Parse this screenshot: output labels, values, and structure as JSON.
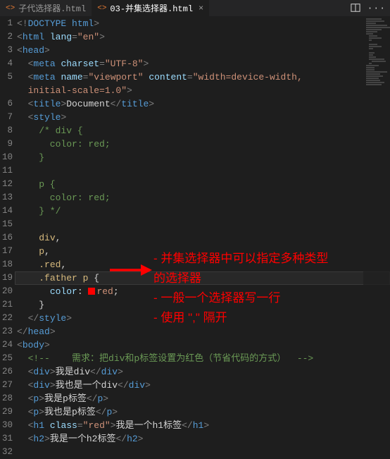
{
  "tabs": {
    "inactive": {
      "icon": "<>",
      "label": "子代选择器.html"
    },
    "active": {
      "icon": "<>",
      "label": "03-并集选择器.html"
    }
  },
  "lineStart": 1,
  "lineEnd": 32,
  "highlightLine": 19,
  "code": {
    "l1_doctype": "DOCTYPE",
    "l1_html": "html",
    "l2_tag": "html",
    "l2_attr": "lang",
    "l2_val": "\"en\"",
    "l3_tag": "head",
    "l4_tag": "meta",
    "l4_attr": "charset",
    "l4_val": "\"UTF-8\"",
    "l5_tag": "meta",
    "l5_attr1": "name",
    "l5_val1": "\"viewport\"",
    "l5_attr2": "content",
    "l5_val2": "\"width=device-width, ",
    "l5b_val": "initial-scale=1.0\"",
    "l6_tag": "title",
    "l6_text": "Document",
    "l7_tag": "style",
    "l8": "    /* div {",
    "l9": "      color: red;",
    "l10": "    }",
    "l12": "    p {",
    "l13": "      color: red;",
    "l14": "    } */",
    "l16_sel": "div",
    "l17_sel": "p",
    "l18_sel": ".red",
    "l19_sel": ".father p",
    "l20_prop": "color",
    "l20_val": "red",
    "l22_tag": "style",
    "l23_tag": "head",
    "l24_tag": "body",
    "l25_comment": "    需求：把div和p标签设置为红色（节省代码的方式）  ",
    "l26_tag": "div",
    "l26_text": "我是div",
    "l27_tag": "div",
    "l27_text": "我也是一个div",
    "l28_tag": "p",
    "l28_text": "我是p标签",
    "l29_tag": "p",
    "l29_text": "我也是p标签",
    "l30_tag": "h1",
    "l30_attr": "class",
    "l30_val": "\"red\"",
    "l30_text": "我是一个h1标签",
    "l31_tag": "h2",
    "l31_text": "我是一个h2标签"
  },
  "annotation": {
    "line1": "- 并集选择器中可以指定多种类型",
    "line2": "的选择器",
    "line3": "- 一般一个选择器写一行",
    "line4": "- 使用 \",\" 隔开"
  }
}
